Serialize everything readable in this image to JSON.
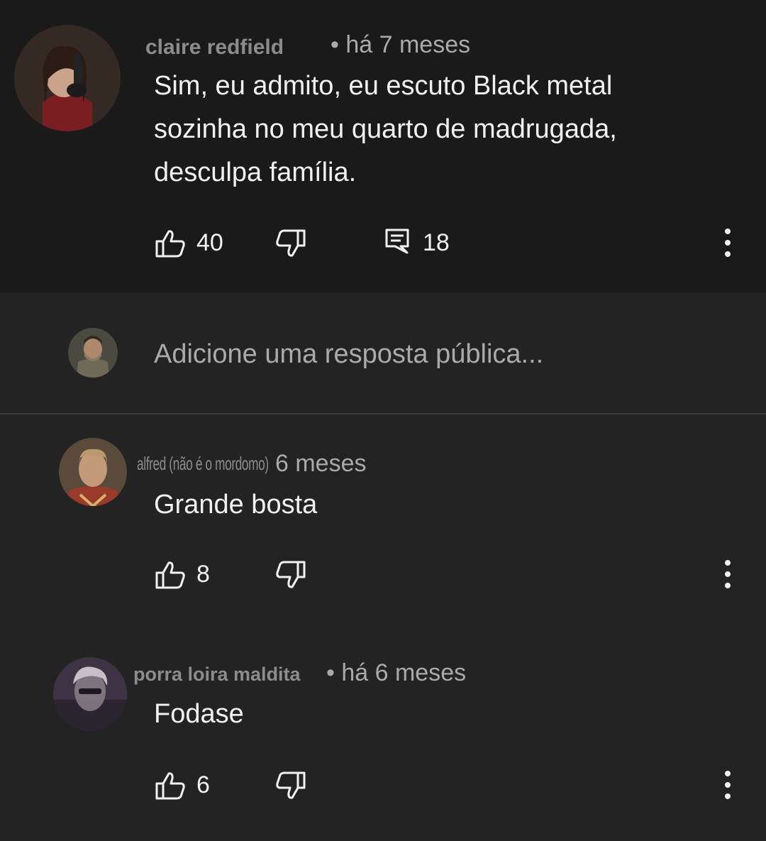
{
  "comments": [
    {
      "author": "claire redfield",
      "time": "• há 7 meses",
      "text": "Sim, eu admito, eu escuto Black metal\nsozinha no meu quarto de madrugada,\ndesculpa família.",
      "likes": "40",
      "replies": "18",
      "avatar_icon": "avatar-woman-with-gun",
      "like_icon": "thumbs-up-icon",
      "dislike_icon": "thumbs-down-icon",
      "reply_icon": "comment-icon",
      "more_icon": "vertical-dots-icon"
    },
    {
      "author": "alfred (não é o mordomo)",
      "time": "6 meses",
      "text": "Grande bosta",
      "likes": "8",
      "avatar_icon": "avatar-man-uniform"
    },
    {
      "author": "porra loira maldita",
      "time": "• há 6 meses",
      "text": "Fodase",
      "likes": "6",
      "avatar_icon": "avatar-man-blurred"
    }
  ],
  "reply_box": {
    "placeholder": "Adicione uma resposta pública...",
    "avatar_icon": "avatar-bearded-man"
  },
  "colors": {
    "top_background": "#1a1a1a",
    "background": "#232323",
    "text": "#f1f1f1",
    "secondary_text": "#aaaaaa",
    "author_text": "#8c8c8c"
  }
}
